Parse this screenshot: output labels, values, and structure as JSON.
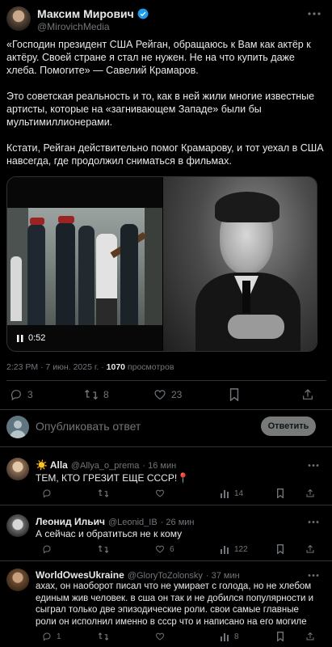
{
  "post": {
    "author_name": "Максим Мирович",
    "author_handle": "@MirovichMedia",
    "paragraphs": [
      "«Господин президент США Рейган, обращаюсь к Вам как актёр к актёру. Своей стране я стал не нужен. Не на что купить даже  хлеба. Помогите» — Савелий Крамаров.",
      "Это советская реальность и то, как в ней жили многие известные артисты, которые на «загнивающем Западе» были бы мультимиллионерами.",
      "Кстати, Рейган действительно помог Крамарову, и тот уехал в США навсегда, где продолжил сниматься в фильмах."
    ],
    "video_duration": "0:52",
    "timestamp": "2:23 PM · 7 июн. 2025 г. · ",
    "views_count": "1070",
    "views_label": " просмотров",
    "stats": {
      "replies": "3",
      "reposts": "8",
      "likes": "23"
    }
  },
  "composer": {
    "placeholder": "Опубликовать ответ",
    "button_label": "Ответить"
  },
  "replies": [
    {
      "name": "☀️ Alla",
      "handle": "@Allya_o_prema",
      "time": "· 16 мин",
      "text": "ТЕМ, КТО ГРЕЗИТ ЕЩЕ СССР!📍",
      "views": "14"
    },
    {
      "name": "Леонид Ильич",
      "handle": "@Leonid_IB",
      "time": "· 26 мин",
      "text": "А сейчас и обратиться не к кому",
      "likes": "6",
      "views": "122"
    },
    {
      "name": "WorldOwesUkraine",
      "handle": "@GloryToZolonsky",
      "time": "· 37 мин",
      "text": "ахах, он наоборот писал что не умирает с голода, но не хлебом единым жив человек. в сша он так и не добился популярности и сыграл только две эпизодические роли. свои самые главные роли он исполнил именно в ссср что и написано на его могиле",
      "replies": "1",
      "views": "8"
    }
  ],
  "colors": {
    "accent": "#1d9bf0",
    "background": "#000000",
    "border": "#2f3336",
    "muted": "#71767b"
  }
}
